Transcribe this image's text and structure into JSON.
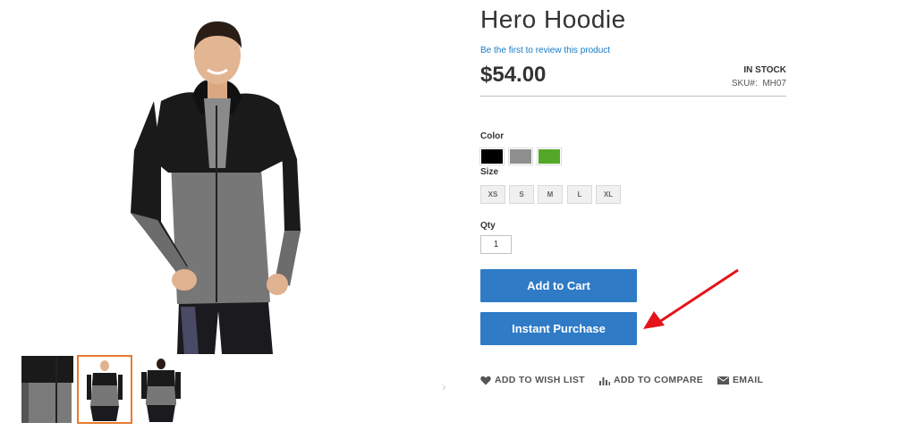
{
  "product": {
    "title": "Hero Hoodie",
    "review_link": "Be the first to review this product",
    "price": "$54.00",
    "stock_status": "IN STOCK",
    "sku_label": "SKU#:",
    "sku_value": "MH07"
  },
  "options": {
    "color_label": "Color",
    "colors": [
      {
        "name": "Black",
        "hex": "#000000"
      },
      {
        "name": "Gray",
        "hex": "#8f8f8f"
      },
      {
        "name": "Green",
        "hex": "#53a828"
      }
    ],
    "size_label": "Size",
    "sizes": [
      "XS",
      "S",
      "M",
      "L",
      "XL"
    ]
  },
  "quantity": {
    "label": "Qty",
    "value": "1"
  },
  "buttons": {
    "add_to_cart": "Add to Cart",
    "instant_purchase": "Instant Purchase"
  },
  "actions": {
    "wishlist": "ADD TO WISH LIST",
    "compare": "ADD TO COMPARE",
    "email": "EMAIL"
  },
  "gallery": {
    "selected_thumb": 2,
    "next_arrow": "›"
  },
  "theme": {
    "accent_blue": "#2f7bc6",
    "link_blue": "#1979c3",
    "thumb_highlight": "#e87b2e",
    "annotation_red": "#e4141b"
  }
}
